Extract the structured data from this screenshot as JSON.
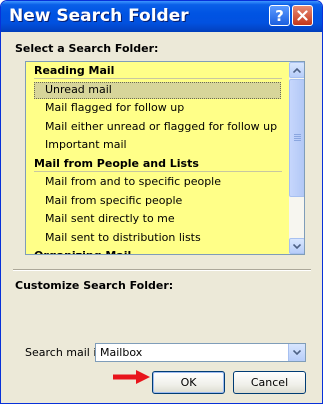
{
  "window": {
    "title": "New Search Folder",
    "help_label": "?",
    "close_label": "✕"
  },
  "select_section": {
    "label": "Select a Search Folder:"
  },
  "list": [
    {
      "kind": "header",
      "label": "Reading Mail"
    },
    {
      "kind": "item",
      "label": "Unread mail",
      "selected": true
    },
    {
      "kind": "item",
      "label": "Mail flagged for follow up"
    },
    {
      "kind": "item",
      "label": "Mail either unread or flagged for follow up"
    },
    {
      "kind": "item",
      "label": "Important mail"
    },
    {
      "kind": "header",
      "label": "Mail from People and Lists"
    },
    {
      "kind": "item",
      "label": "Mail from and to specific people"
    },
    {
      "kind": "item",
      "label": "Mail from specific people"
    },
    {
      "kind": "item",
      "label": "Mail sent directly to me"
    },
    {
      "kind": "item",
      "label": "Mail sent to distribution lists"
    },
    {
      "kind": "header",
      "label": "Organizing Mail"
    }
  ],
  "customize_section": {
    "label": "Customize Search Folder:"
  },
  "search_in": {
    "label": "Search mail in:",
    "value": "Mailbox"
  },
  "buttons": {
    "ok": "OK",
    "cancel": "Cancel"
  },
  "colors": {
    "list_background": "#ffff88",
    "title_bar": "#0054e3",
    "pointer_arrow": "#e8141b"
  }
}
